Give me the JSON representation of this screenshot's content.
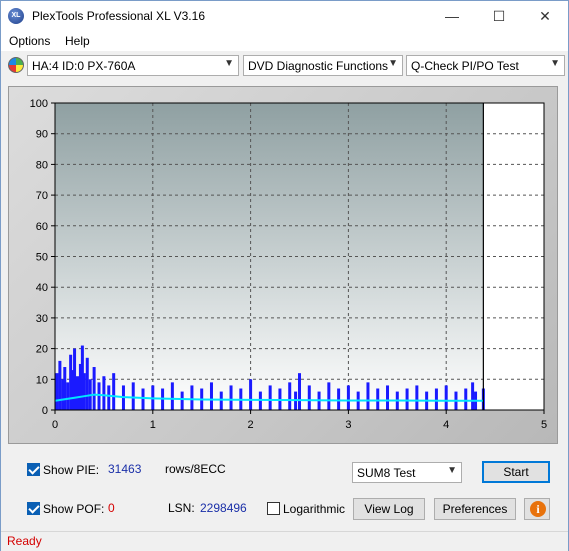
{
  "window": {
    "title": "PlexTools Professional XL V3.16",
    "icon_text": "XL"
  },
  "titlebar_buttons": {
    "minimize": "—",
    "maximize": "☐",
    "close": "✕"
  },
  "menu": {
    "options": "Options",
    "help": "Help"
  },
  "toolbar": {
    "drive": "HA:4 ID:0  PX-760A",
    "function": "DVD Diagnostic Functions",
    "test": "Q-Check PI/PO Test"
  },
  "chart_data": {
    "type": "bar",
    "xlim": [
      0,
      5
    ],
    "ylim": [
      0,
      100
    ],
    "x_ticks": [
      "0",
      "1",
      "2",
      "3",
      "4",
      "5"
    ],
    "y_ticks": [
      "0",
      "10",
      "20",
      "30",
      "40",
      "50",
      "60",
      "70",
      "80",
      "90",
      "100"
    ],
    "data_end_x": 4.38,
    "grid": true,
    "series": [
      {
        "role": "pie",
        "color": "#1a1aff",
        "x": [
          0.02,
          0.05,
          0.08,
          0.1,
          0.13,
          0.16,
          0.18,
          0.2,
          0.23,
          0.26,
          0.28,
          0.3,
          0.33,
          0.36,
          0.4,
          0.45,
          0.5,
          0.55,
          0.6,
          0.7,
          0.8,
          0.9,
          1.0,
          1.1,
          1.2,
          1.3,
          1.4,
          1.5,
          1.6,
          1.7,
          1.8,
          1.9,
          2.0,
          2.1,
          2.2,
          2.3,
          2.4,
          2.46,
          2.5,
          2.6,
          2.7,
          2.8,
          2.9,
          3.0,
          3.1,
          3.2,
          3.3,
          3.4,
          3.5,
          3.6,
          3.7,
          3.8,
          3.9,
          4.0,
          4.1,
          4.2,
          4.27,
          4.3,
          4.38
        ],
        "values": [
          12,
          16,
          10,
          14,
          9,
          18,
          13,
          20,
          11,
          15,
          21,
          12,
          17,
          10,
          14,
          9,
          11,
          8,
          12,
          8,
          9,
          7,
          8,
          7,
          9,
          6,
          8,
          7,
          9,
          6,
          8,
          7,
          10,
          6,
          8,
          7,
          9,
          6,
          12,
          8,
          6,
          9,
          7,
          8,
          6,
          9,
          7,
          8,
          6,
          7,
          8,
          6,
          7,
          8,
          6,
          7,
          9,
          6,
          7
        ]
      },
      {
        "role": "average",
        "color": "#00e5ff",
        "x": [
          0,
          0.1,
          0.2,
          0.3,
          0.4,
          0.5,
          0.7,
          1.0,
          1.5,
          2.0,
          2.5,
          3.0,
          3.5,
          4.0,
          4.38
        ],
        "values": [
          3,
          3.5,
          4,
          4.5,
          5,
          4.8,
          4.2,
          3.8,
          3.4,
          3.3,
          3.2,
          3.1,
          3.1,
          3.0,
          3.0
        ]
      }
    ]
  },
  "bottom": {
    "show_pie_label": "Show PIE:",
    "pie_value": "31463",
    "pie_unit": "rows/8ECC",
    "show_pof_label": "Show POF:",
    "pof_value": "0",
    "lsn_label": "LSN:",
    "lsn_value": "2298496",
    "logarithmic_label": "Logarithmic",
    "test_select": "SUM8 Test",
    "start_button": "Start",
    "view_log_button": "View Log",
    "preferences_button": "Preferences",
    "info_icon": "i"
  },
  "status": "Ready"
}
